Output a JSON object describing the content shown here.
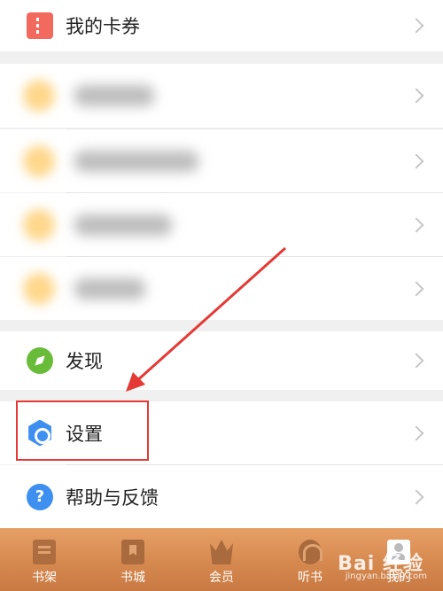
{
  "menu": {
    "coupons_label": "我的卡券",
    "discover_label": "发现",
    "settings_label": "设置",
    "help_label": "帮助与反馈"
  },
  "tabbar": {
    "tabs": [
      {
        "label": "书架",
        "icon": "bookshelf-icon"
      },
      {
        "label": "书城",
        "icon": "bookstore-icon"
      },
      {
        "label": "会员",
        "icon": "crown-icon"
      },
      {
        "label": "听书",
        "icon": "headphone-icon"
      },
      {
        "label": "我的",
        "icon": "profile-icon"
      }
    ]
  },
  "watermark": {
    "text": "Bai 经验",
    "sub": "jingyan.baidu.com"
  },
  "colors": {
    "coupon": "#f26a5e",
    "discover": "#69bc39",
    "settings": "#3d8ff0",
    "help": "#3d8ff0",
    "annotation": "#e53935"
  }
}
